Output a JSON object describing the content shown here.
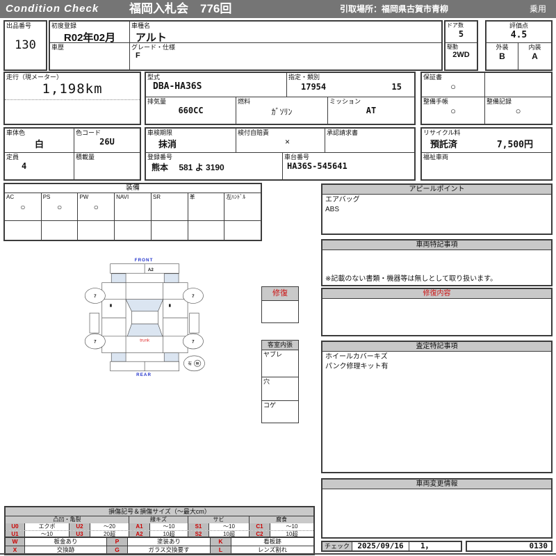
{
  "colors": {
    "header_bg": "#757575",
    "section_header_bg": "#c9c9c9",
    "accent_red": "#cc1111",
    "accent_blue": "#2233cc",
    "glass_shade": "#dbe5f1"
  },
  "header": {
    "brand": "Condition  Check",
    "auction": "福岡入札会　776回",
    "pickup": "引取場所：福岡県古賀市青柳",
    "category": "乗用"
  },
  "fields": {
    "exhibit_no_label": "出品番号",
    "exhibit_no": "130",
    "first_reg_label": "初度登録",
    "first_reg": "R02年02月",
    "model_label": "車種名",
    "model": "アルト",
    "history_label": "車歴",
    "grade_label": "グレード・仕様",
    "grade": "F",
    "doors_label": "ドア数",
    "doors": "5",
    "drive_label": "駆動",
    "drive": "2WD",
    "score_label": "評価点",
    "score": "4.5",
    "exterior_label": "外装",
    "exterior": "B",
    "interior_label": "内装",
    "interior": "A",
    "mileage_label": "走行（現メーター）",
    "mileage": "1,198km",
    "model_code_label": "型式",
    "model_code": "DBA-HA36S",
    "class_label": "指定・類別",
    "class_no": "17954",
    "class_sub": "15",
    "warranty_label": "保証書",
    "warranty_mark": "○",
    "displacement_label": "排気量",
    "displacement": "660CC",
    "fuel_label": "燃料",
    "fuel": "ｶﾞｿﾘﾝ",
    "mission_label": "ミッション",
    "mission": "AT",
    "maint_book_label": "整備手帳",
    "maint_book_mark": "○",
    "maint_rec_label": "整備記録",
    "maint_rec_mark": "○",
    "body_color_label": "車体色",
    "body_color": "白",
    "color_code_label": "色コード",
    "color_code": "26U",
    "inspection_label": "車検期限",
    "inspection": "抹消",
    "insurance_label": "検付自賠責",
    "insurance_mark": "×",
    "approval_label": "承認請求書",
    "recycle_label": "リサイクル料",
    "recycle_status": "預託済",
    "recycle_fee": "7,500円",
    "capacity_label": "定員",
    "capacity": "4",
    "load_label": "積載量",
    "reg_no_label": "登録番号",
    "reg_no": "熊本　 581 よ 3190",
    "chassis_label": "車台番号",
    "chassis_no": "HA36S-545641",
    "welfare_label": "福祉車両"
  },
  "equipment": {
    "title": "装備",
    "columns": [
      {
        "label": "AC",
        "mark": "○"
      },
      {
        "label": "PS",
        "mark": "○"
      },
      {
        "label": "PW",
        "mark": "○"
      },
      {
        "label": "NAVI",
        "mark": ""
      },
      {
        "label": "SR",
        "mark": ""
      },
      {
        "label": "革",
        "mark": ""
      },
      {
        "label": "左ﾊﾝﾄﾞﾙ",
        "mark": ""
      }
    ]
  },
  "panels": {
    "appeal": {
      "title": "アピールポイント",
      "body": "エアバッグ\nABS"
    },
    "notes": {
      "title": "車両特記事項",
      "footnote": "※記載のない書類・機器等は無しとして取り扱います。"
    },
    "repair": {
      "title": "修復内容"
    },
    "assessment": {
      "title": "査定特記事項",
      "body": "ホイールカバーキズ\nパンク修理キット有"
    },
    "changes": {
      "title": "車両変更情報"
    },
    "check": {
      "label": "チェック",
      "date": "2025/09/16",
      "value": "1，",
      "code": "0130"
    }
  },
  "diagram": {
    "front_label": "FRONT",
    "rear_label": "REAR",
    "trunk_label": "trunk",
    "damage_mark": "A2",
    "tires": {
      "fl": "7",
      "fr": "7",
      "rl": "7",
      "rr": "7"
    },
    "spare": {
      "present": "有",
      "absent": "無"
    },
    "repair_box_title": "修復",
    "interior_box": {
      "title": "客室内張",
      "row1": "ヤブレ",
      "row2": "穴",
      "row3": "コゲ"
    }
  },
  "legend": {
    "title": "損傷記号＆損傷サイズ（〜最大cm）",
    "groups": [
      "凸凹・亀裂",
      "線キズ",
      "サビ",
      "腐食"
    ],
    "rows": [
      [
        "U0",
        "エクボ",
        "U2",
        "〜20",
        "A1",
        "〜10",
        "S1",
        "〜10",
        "C1",
        "〜10"
      ],
      [
        "U1",
        "〜10",
        "U3",
        "20超",
        "A2",
        "10超",
        "S2",
        "10超",
        "C2",
        "10超"
      ]
    ],
    "rows2": [
      [
        "W",
        "板金あり",
        "P",
        "塗装あり",
        "K",
        "看板跡"
      ],
      [
        "X",
        "交換跡",
        "G",
        "ガラス交換要す",
        "L",
        "レンズ割れ"
      ]
    ]
  }
}
